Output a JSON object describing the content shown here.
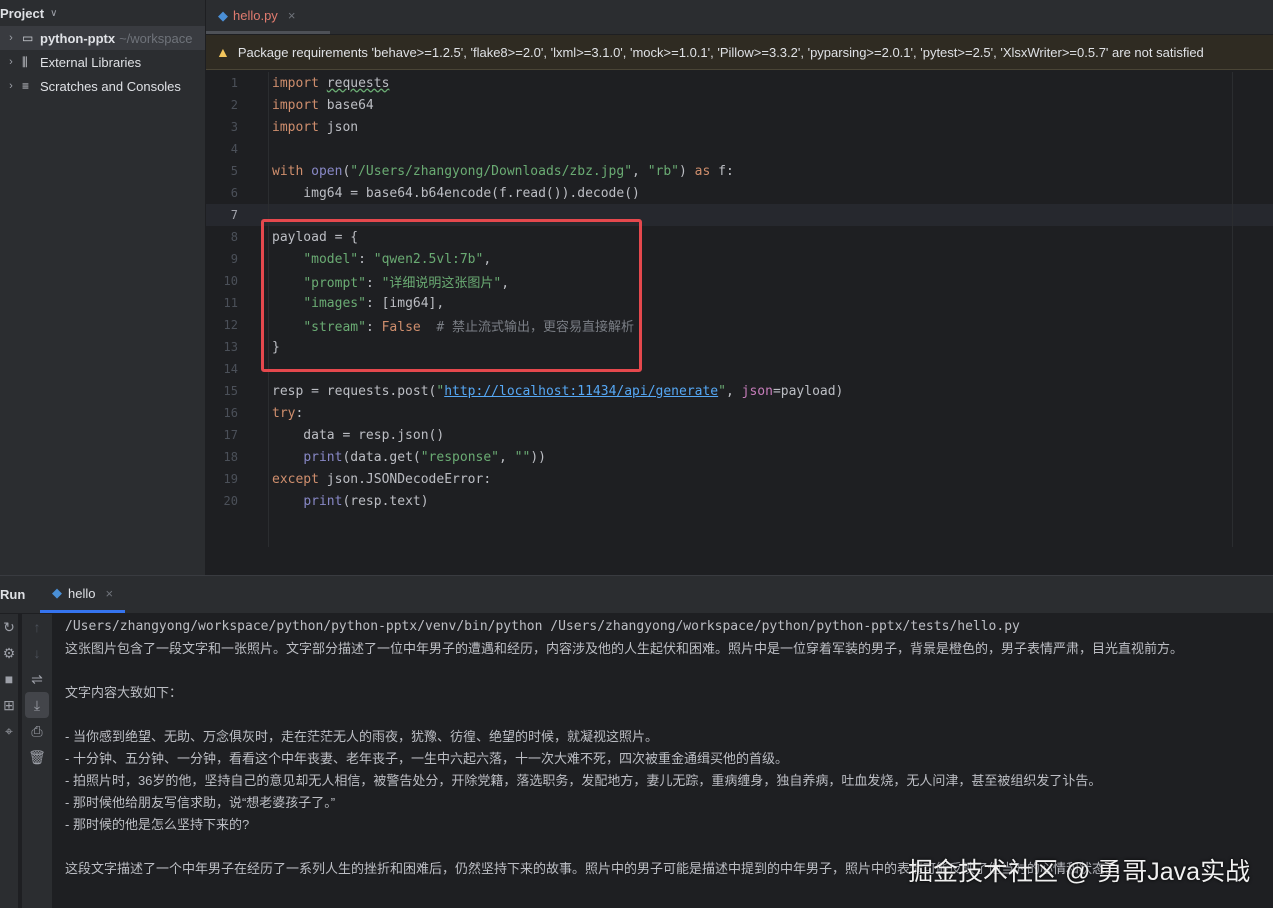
{
  "sidebar": {
    "title": "Project",
    "items": [
      {
        "label": "python-pptx",
        "sub": "~/workspace",
        "icon": "folder-icon"
      },
      {
        "label": "External Libraries",
        "icon": "library-icon"
      },
      {
        "label": "Scratches and Consoles",
        "icon": "scratches-icon"
      }
    ]
  },
  "editor": {
    "tab": "hello.py",
    "banner": "Package requirements 'behave>=1.2.5', 'flake8>=2.0', 'lxml>=3.1.0', 'mock>=1.0.1', 'Pillow>=3.3.2', 'pyparsing>=2.0.1', 'pytest>=2.5', 'XlsxWriter>=0.5.7' are not satisfied",
    "current_line": 7,
    "lines": [
      [
        [
          "import",
          "kw"
        ],
        [
          " "
        ],
        [
          "requests",
          "sq"
        ]
      ],
      [
        [
          "import",
          "kw"
        ],
        [
          " base64"
        ]
      ],
      [
        [
          "import",
          "kw"
        ],
        [
          " json"
        ]
      ],
      [],
      [
        [
          "with",
          "kw"
        ],
        [
          " "
        ],
        [
          "open",
          "bi"
        ],
        [
          "("
        ],
        [
          "\"/Users/zhangyong/Downloads/zbz.jpg\"",
          "str"
        ],
        [
          ", "
        ],
        [
          "\"rb\"",
          "str"
        ],
        [
          ") "
        ],
        [
          "as",
          "kw"
        ],
        [
          " f:"
        ]
      ],
      [
        [
          "    img64 = base64.b64encode(f.read()).decode()"
        ]
      ],
      [],
      [
        [
          "payload = {"
        ]
      ],
      [
        [
          "    "
        ],
        [
          "\"model\"",
          "str"
        ],
        [
          ": "
        ],
        [
          "\"qwen2.5vl:7b\"",
          "str"
        ],
        [
          ","
        ]
      ],
      [
        [
          "    "
        ],
        [
          "\"prompt\"",
          "str"
        ],
        [
          ": "
        ],
        [
          "\"详细说明这张图片\"",
          "str"
        ],
        [
          ","
        ]
      ],
      [
        [
          "    "
        ],
        [
          "\"images\"",
          "str"
        ],
        [
          ": [img64],"
        ]
      ],
      [
        [
          "    "
        ],
        [
          "\"stream\"",
          "str"
        ],
        [
          ": "
        ],
        [
          "False",
          "kw"
        ],
        [
          "  "
        ],
        [
          "# 禁止流式输出，更容易直接解析",
          "cm"
        ]
      ],
      [
        [
          "}"
        ]
      ],
      [],
      [
        [
          "resp = requests.post("
        ],
        [
          "\"",
          "str"
        ],
        [
          "http://localhost:11434/api/generate",
          "url"
        ],
        [
          "\"",
          "str"
        ],
        [
          ", "
        ],
        [
          "json",
          "key"
        ],
        [
          "=payload)"
        ]
      ],
      [
        [
          "try",
          "kw"
        ],
        [
          ":"
        ]
      ],
      [
        [
          "    data = resp.json()"
        ]
      ],
      [
        [
          "    "
        ],
        [
          "print",
          "bi"
        ],
        [
          "(data.get("
        ],
        [
          "\"response\"",
          "str"
        ],
        [
          ", "
        ],
        [
          "\"\"",
          "str"
        ],
        [
          "))"
        ]
      ],
      [
        [
          "except",
          "kw"
        ],
        [
          " json.JSONDecodeError:"
        ]
      ],
      [
        [
          "    "
        ],
        [
          "print",
          "bi"
        ],
        [
          "(resp.text)"
        ]
      ]
    ]
  },
  "run": {
    "title": "Run",
    "tab": "hello",
    "lines": [
      "/Users/zhangyong/workspace/python/python-pptx/venv/bin/python /Users/zhangyong/workspace/python/python-pptx/tests/hello.py",
      "这张图片包含了一段文字和一张照片。文字部分描述了一位中年男子的遭遇和经历，内容涉及他的人生起伏和困难。照片中是一位穿着军装的男子，背景是橙色的，男子表情严肃，目光直视前方。",
      "",
      "文字内容大致如下：",
      "",
      "- 当你感到绝望、无助、万念俱灰时，走在茫茫无人的雨夜，犹豫、彷徨、绝望的时候，就凝视这照片。",
      "- 十分钟、五分钟、一分钟，看看这个中年丧妻、老年丧子，一生中六起六落，十一次大难不死，四次被重金通缉买他的首级。",
      "- 拍照片时，36岁的他，坚持自己的意见却无人相信，被警告处分，开除党籍，落选职务，发配地方，妻儿无踪，重病缠身，独自养病，吐血发烧，无人问津，甚至被组织发了讣告。",
      "- 那时候他给朋友写信求助，说“想老婆孩子了。”",
      "- 那时候的他是怎么坚持下来的?",
      "",
      "这段文字描述了一个中年男子在经历了一系列人生的挫折和困难后，仍然坚持下来的故事。照片中的男子可能是描述中提到的中年男子，照片中的表情可能反映了他当时的心情和状态。"
    ]
  },
  "watermark": "掘金技术社区 @ 勇哥Java实战"
}
